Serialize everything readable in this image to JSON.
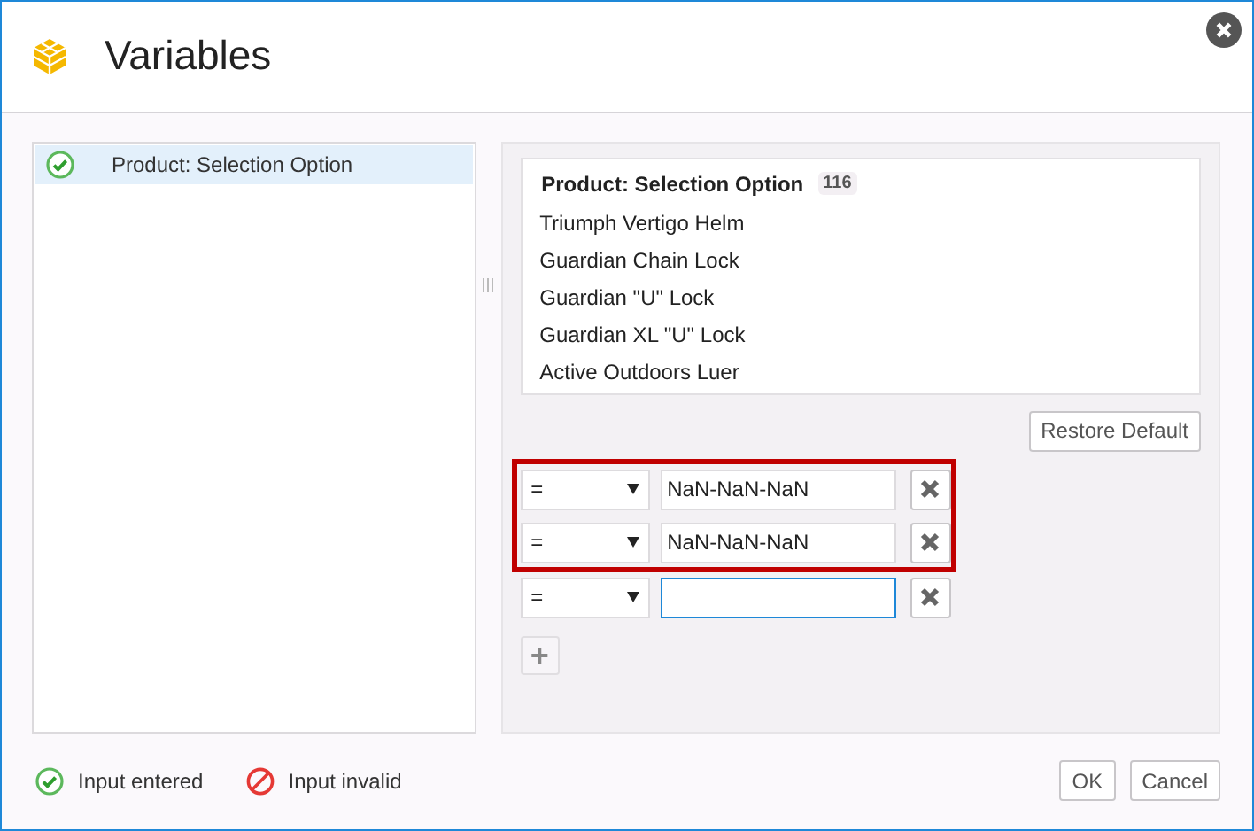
{
  "window": {
    "title": "Variables"
  },
  "variables": [
    {
      "label": "Product: Selection Option",
      "valid": true,
      "selected": true
    }
  ],
  "values_list": {
    "title": "Product: Selection Option",
    "count": "116",
    "items": [
      "Triumph Vertigo Helm",
      "Guardian Chain Lock",
      "Guardian \"U\" Lock",
      "Guardian XL \"U\" Lock",
      "Active Outdoors Luer"
    ]
  },
  "restore_button": "Restore Default",
  "conditions": [
    {
      "operator": "=",
      "value": "NaN-NaN-NaN",
      "highlighted": true,
      "focused": false
    },
    {
      "operator": "=",
      "value": "NaN-NaN-NaN",
      "highlighted": true,
      "focused": false
    },
    {
      "operator": "=",
      "highlighted": false,
      "focused": true
    }
  ],
  "add_button": "+",
  "legend": [
    {
      "kind": "entered",
      "label": "Input entered"
    },
    {
      "kind": "invalid",
      "label": "Input invalid"
    }
  ],
  "buttons": [
    "OK",
    "Cancel"
  ]
}
